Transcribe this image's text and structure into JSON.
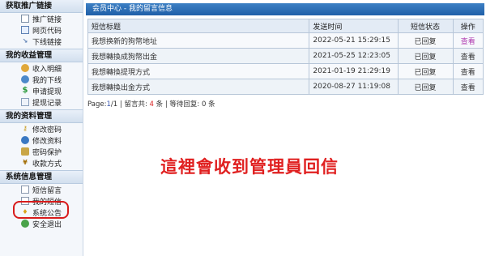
{
  "sidebar": {
    "sections": [
      {
        "title": "获取推广链接",
        "items": [
          {
            "label": "推广链接",
            "icon": "document-icon"
          },
          {
            "label": "网页代码",
            "icon": "code-icon"
          },
          {
            "label": "下线链接",
            "icon": "link-icon"
          }
        ]
      },
      {
        "title": "我的收益管理",
        "items": [
          {
            "label": "收入明细",
            "icon": "coin-icon"
          },
          {
            "label": "我的下线",
            "icon": "user-icon"
          },
          {
            "label": "申请提现",
            "icon": "dollar-icon"
          },
          {
            "label": "提现记录",
            "icon": "list-icon"
          }
        ]
      },
      {
        "title": "我的资料管理",
        "items": [
          {
            "label": "修改密码",
            "icon": "key-icon"
          },
          {
            "label": "修改资料",
            "icon": "users-icon"
          },
          {
            "label": "密码保护",
            "icon": "lock-icon"
          },
          {
            "label": "收款方式",
            "icon": "yen-icon"
          }
        ]
      },
      {
        "title": "系统信息管理",
        "items": [
          {
            "label": "短信留言",
            "icon": "mail-icon"
          },
          {
            "label": "我的短信",
            "icon": "mail-icon"
          },
          {
            "label": "系统公告",
            "icon": "bell-icon"
          },
          {
            "label": "安全退出",
            "icon": "exit-icon"
          }
        ]
      }
    ]
  },
  "header": {
    "breadcrumb": "会员中心 - 我的留言信息"
  },
  "table": {
    "columns": {
      "title": "短信标题",
      "time": "发送时间",
      "status": "短信状态",
      "op": "操作"
    },
    "rows": [
      {
        "title": "我想换新的狗幣地址",
        "time": "2022-05-21 15:29:15",
        "status": "已回复",
        "op": "查看"
      },
      {
        "title": "我想轉換成狗幣出金",
        "time": "2021-05-25 12:23:05",
        "status": "已回复",
        "op": "查看"
      },
      {
        "title": "我想轉換提現方式",
        "time": "2021-01-19 21:29:19",
        "status": "已回复",
        "op": "查看"
      },
      {
        "title": "我想轉換出金方式",
        "time": "2020-08-27 11:19:08",
        "status": "已回复",
        "op": "查看"
      }
    ]
  },
  "pager": {
    "page_label": "Page:",
    "page_current": "1",
    "page_sep": "/",
    "page_total": "1",
    "count_prefix": " | 留言共: ",
    "count_total": "4",
    "count_unit": " 条",
    "pending_prefix": " | 等待回复: ",
    "pending_count": "0",
    "pending_unit": " 条"
  },
  "annotation": {
    "text": "這裡會收到管理員回信"
  },
  "colors": {
    "accent_blue": "#1f5fa8",
    "status_red": "#d81e1e",
    "annotation_red": "#e02020",
    "link_blue": "#3a7abf",
    "link_visited": "#b03cb0"
  }
}
